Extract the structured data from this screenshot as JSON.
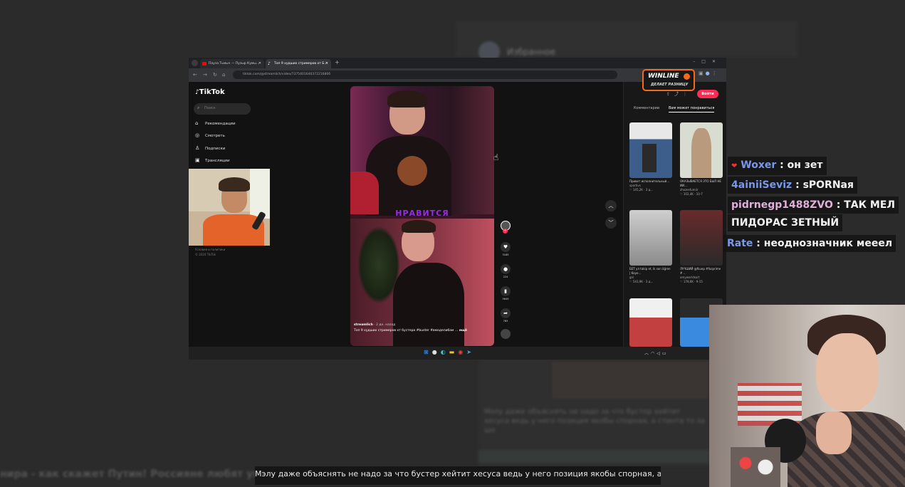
{
  "background": {
    "contact_name": "Избранное",
    "bottom_blur_text": "Мэлу даже объяснять не надо за что бустер хейтит хесуса ведь у него позиция якобы спорная, а стинта то за шо"
  },
  "browser": {
    "tabs": [
      {
        "label": "Пауза Тьмыч — Пузыр Кумы…",
        "active": false
      },
      {
        "label": "Топ 9 худших стримеров от Б…",
        "active": true
      }
    ],
    "url": "tiktok.com/@streamlich/video/7375401640372216866"
  },
  "tiktok": {
    "logo": "TikTok",
    "search_placeholder": "Поиск",
    "nav": [
      {
        "label": "Рекомендации",
        "icon": "home-icon"
      },
      {
        "label": "Смотреть",
        "icon": "compass-icon"
      },
      {
        "label": "Подписки",
        "icon": "user-icon"
      },
      {
        "label": "Трансляции",
        "icon": "live-icon"
      }
    ],
    "footer": [
      "Условия и политики",
      "© 2024 TikTok"
    ],
    "video": {
      "overlay_text": "НРАВИТСЯ",
      "author": "streamlich",
      "date": "· 2 дн. назад",
      "description": "Топ 9 худших стримеров от бустера #buster #вмоделибам …",
      "more": "ещё",
      "counts": [
        "3185",
        "224",
        "5649",
        "783"
      ]
    },
    "right_panel": {
      "login_button": "Войти",
      "tabs": [
        "Комментарии",
        "Вам может понравиться"
      ],
      "thumbs": [
        {
          "caption": "Привет исполнительный…",
          "author": "sportivs",
          "stats": "♡ 145,2K · 3 д…"
        },
        {
          "caption": "ОКАЗЫВАЕТСЯ ЭТО БЫЛ НЕ ИИ…",
          "author": "zhozesfumiir",
          "stats": "♡ 102,4K · 10-7"
        },
        {
          "caption": "БЕТ ул takip et, ik son öğren | Kayo…",
          "author": "gnl",
          "stats": "♡ 543,9K · 3 д…"
        },
        {
          "caption": "ЛУЧШИЙ @fkuep #fazprime # …",
          "author": "amyworldsort",
          "stats": "♡ 178,6K · 9-15"
        }
      ]
    }
  },
  "ad_badge": {
    "brand": "WINLINE",
    "tagline": "ДЕЛАЕТ РАЗНИЦУ"
  },
  "chat": [
    {
      "user": "Woxer",
      "message": "он зет",
      "color": "#7b98e8",
      "badge": true
    },
    {
      "user": "4ainiiSeviz",
      "message": "sPORNая",
      "color": "#7b98e8",
      "badge": false
    },
    {
      "user": "pidrnegp1488ZVO",
      "message": "ТАК МЕЛ ПИДОРАС ЗЕТНЫЙ",
      "color": "#e0b0d8",
      "badge": false
    },
    {
      "user": "Rate",
      "message": "неоднозначник мееел",
      "color": "#7b98e8",
      "badge": false
    }
  ],
  "chat_parts": {
    "line3a": "pidrnegp1488ZVO : ТАК МЕЛ",
    "line3b": "ПИДОРАС ЗЕТНЫЙ"
  },
  "ticker": "нира - как скажет Путин! Россияне любят украин",
  "subtitle": "Мэлу даже объяснять не надо за что бустер хейтит хесуса ведь у него позиция якобы спорная, а стинта то за шо",
  "colors": {
    "tiktok_red": "#fe2c55",
    "winline_orange": "#f26a1b"
  }
}
